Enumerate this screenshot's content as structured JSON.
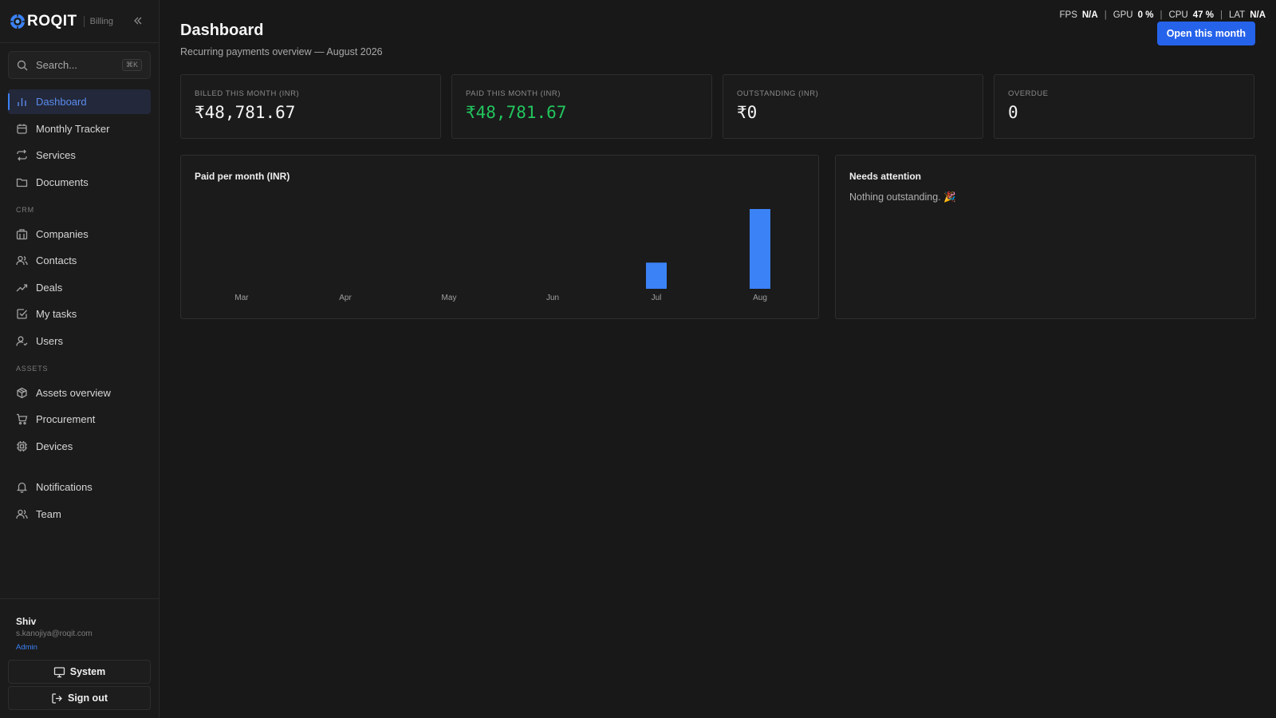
{
  "brand": {
    "name": "ROQIT",
    "sub": "Billing"
  },
  "search": {
    "placeholder": "Search...",
    "shortcut": "⌘K"
  },
  "nav": {
    "main": [
      {
        "label": "Dashboard",
        "icon": "bar-chart-icon",
        "active": true
      },
      {
        "label": "Monthly Tracker",
        "icon": "calendar-icon"
      },
      {
        "label": "Services",
        "icon": "repeat-icon"
      },
      {
        "label": "Documents",
        "icon": "folder-icon"
      }
    ],
    "crm_label": "CRM",
    "crm": [
      {
        "label": "Companies",
        "icon": "building-icon"
      },
      {
        "label": "Contacts",
        "icon": "users-icon"
      },
      {
        "label": "Deals",
        "icon": "trending-up-icon"
      },
      {
        "label": "My tasks",
        "icon": "check-square-icon"
      },
      {
        "label": "Users",
        "icon": "user-check-icon"
      }
    ],
    "assets_label": "ASSETS",
    "assets": [
      {
        "label": "Assets overview",
        "icon": "package-icon"
      },
      {
        "label": "Procurement",
        "icon": "cart-icon"
      },
      {
        "label": "Devices",
        "icon": "chip-icon"
      }
    ],
    "other": [
      {
        "label": "Notifications",
        "icon": "bell-icon"
      },
      {
        "label": "Team",
        "icon": "users-icon"
      }
    ]
  },
  "user": {
    "name": "Shiv",
    "email": "s.kanojiya@roqit.com",
    "role": "Admin"
  },
  "buttons": {
    "system": "System",
    "signout": "Sign out",
    "open_month": "Open this month"
  },
  "header": {
    "title": "Dashboard",
    "subtitle": "Recurring payments overview — August 2026"
  },
  "stats": {
    "fps_label": "FPS",
    "fps": "N/A",
    "gpu_label": "GPU",
    "gpu": "0 %",
    "cpu_label": "CPU",
    "cpu": "47 %",
    "lat_label": "LAT",
    "lat": "N/A"
  },
  "cards": [
    {
      "label": "BILLED THIS MONTH (INR)",
      "value": "₹48,781.67"
    },
    {
      "label": "PAID THIS MONTH (INR)",
      "value": "₹48,781.67"
    },
    {
      "label": "OUTSTANDING (INR)",
      "value": "₹0"
    },
    {
      "label": "OVERDUE",
      "value": "0"
    }
  ],
  "chart_panel": {
    "title": "Paid per month (INR)"
  },
  "chart_data": {
    "type": "bar",
    "categories": [
      "Mar",
      "Apr",
      "May",
      "Jun",
      "Jul",
      "Aug"
    ],
    "values": [
      0,
      0,
      0,
      0,
      16000,
      48781.67
    ],
    "title": "Paid per month (INR)",
    "xlabel": "",
    "ylabel": "",
    "grid": false,
    "color": "#3b82f6"
  },
  "attention": {
    "title": "Needs attention",
    "text": "Nothing outstanding. 🎉"
  },
  "colors": {
    "accent": "#2563eb",
    "bar": "#3b82f6",
    "positive": "#22c55e"
  }
}
